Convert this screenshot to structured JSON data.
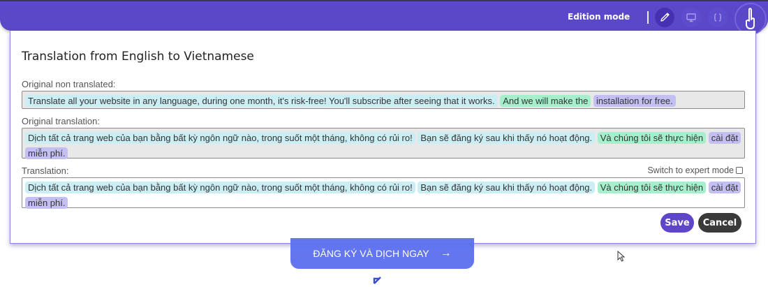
{
  "toolbar": {
    "mode_label": "Edition mode",
    "icons": [
      "pencil-icon",
      "monitor-icon",
      "braces-icon"
    ],
    "accent": "#5b48c9"
  },
  "dialog": {
    "title": "Translation from English to Vietnamese",
    "original_label": "Original non translated:",
    "original_segments": [
      "Translate all your website in any language, during one month, it's risk-free! You'll subscribe after seeing that it works.",
      "And we will make the",
      "installation for free."
    ],
    "orig_translation_label": "Original translation:",
    "orig_translation_segments": [
      "Dịch tất cả trang web của bạn bằng bất kỳ ngôn ngữ nào, trong suốt một tháng, không có rủi ro!",
      "Bạn sẽ đăng ký sau khi thấy nó hoạt động.",
      "Và chúng tôi sẽ thực hiện",
      "cài đặt miễn phí."
    ],
    "translation_label": "Translation:",
    "expert_mode_label": "Switch to expert mode",
    "translation_segments": [
      "Dịch tất cả trang web của bạn bằng bất kỳ ngôn ngữ nào, trong suốt một tháng, không có rủi ro!",
      "Bạn sẽ đăng ký sau khi thấy nó hoạt động.",
      "Và chúng tôi sẽ thực hiện",
      "cài đặt miễn phí."
    ],
    "save_label": "Save",
    "cancel_label": "Cancel"
  },
  "page": {
    "cta_label": "ĐĂNG KÝ VÀ DỊCH NGAY",
    "cta_arrow": "→"
  }
}
